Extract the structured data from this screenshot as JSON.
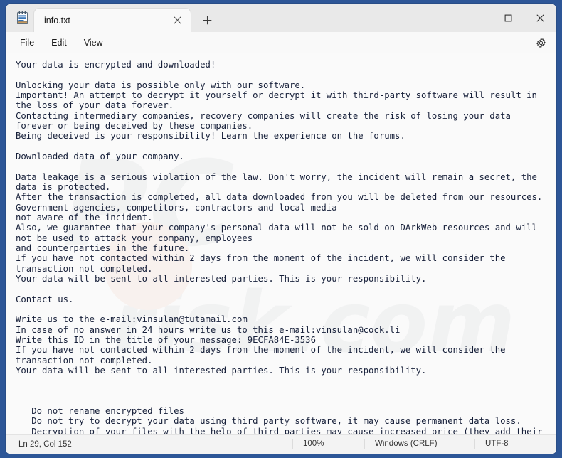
{
  "window": {
    "app_icon": "notepad-icon",
    "minimize_label": "—",
    "maximize_label": "☐",
    "close_label": "✕"
  },
  "tabs": [
    {
      "title": "info.txt",
      "close_label": "✕"
    }
  ],
  "new_tab_label": "+",
  "menubar": {
    "items": [
      "File",
      "Edit",
      "View"
    ],
    "settings_icon": "gear-icon"
  },
  "editor": {
    "content": "Your data is encrypted and downloaded!\n\nUnlocking your data is possible only with our software.\nImportant! An attempt to decrypt it yourself or decrypt it with third-party software will result in the loss of your data forever.\nContacting intermediary companies, recovery companies will create the risk of losing your data forever or being deceived by these companies.\nBeing deceived is your responsibility! Learn the experience on the forums.\n\nDownloaded data of your company.\n\nData leakage is a serious violation of the law. Don't worry, the incident will remain a secret, the data is protected.\nAfter the transaction is completed, all data downloaded from you will be deleted from our resources. Government agencies, competitors, contractors and local media\nnot aware of the incident.\nAlso, we guarantee that your company's personal data will not be sold on DArkWeb resources and will not be used to attack your company, employees\nand counterparties in the future.\nIf you have not contacted within 2 days from the moment of the incident, we will consider the transaction not completed.\nYour data will be sent to all interested parties. This is your responsibility.\n\nContact us.\n\nWrite us to the e-mail:vinsulan@tutamail.com\nIn case of no answer in 24 hours write us to this e-mail:vinsulan@cock.li\nWrite this ID in the title of your message: 9ECFA84E-3536\nIf you have not contacted within 2 days from the moment of the incident, we will consider the transaction not completed.\nYour data will be sent to all interested parties. This is your responsibility.\n\n\n\n   Do not rename encrypted files\n   Do not try to decrypt your data using third party software, it may cause permanent data loss.\n   Decryption of your files with the help of third parties may cause increased price (they add their fee to our) or you can become a victim of a scam."
  },
  "statusbar": {
    "position": "Ln 29, Col 152",
    "zoom": "100%",
    "line_ending": "Windows (CRLF)",
    "encoding": "UTF-8"
  },
  "colors": {
    "desktop": "#2d5697",
    "window_bg": "#fafafa",
    "text": "#17203a",
    "titlebar": "#e9e9e9",
    "statusbar": "#f3f3f3"
  }
}
